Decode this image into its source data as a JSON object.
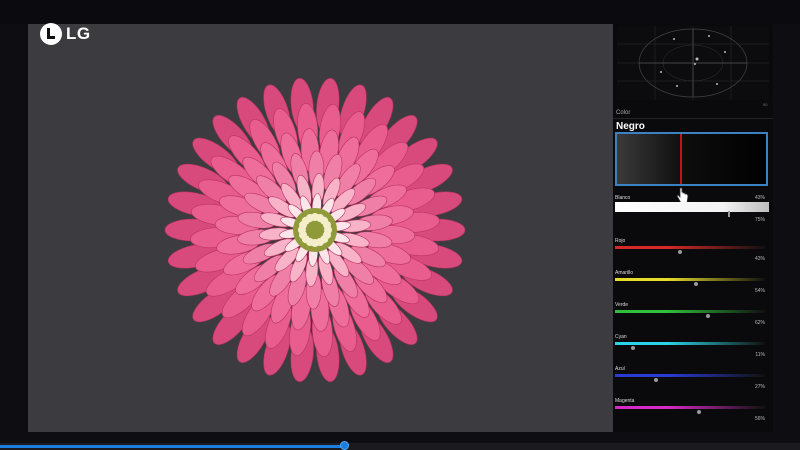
{
  "brand": {
    "logo_text": "LG"
  },
  "scope": {
    "label": "50"
  },
  "panel": {
    "title": "Color",
    "selected_color": "Negro"
  },
  "blanco": {
    "label": "Blanco",
    "percent_top": "43%",
    "percent_bottom": "75%",
    "level": 0.75
  },
  "sliders": [
    {
      "label": "Rojo",
      "percent": "43%",
      "color": "#d62828",
      "level": 0.43
    },
    {
      "label": "Amarillo",
      "percent": "54%",
      "color": "#e6dc2b",
      "level": 0.54
    },
    {
      "label": "Verde",
      "percent": "62%",
      "color": "#2fbf3a",
      "level": 0.62
    },
    {
      "label": "Cyan",
      "percent": "11%",
      "color": "#2ad4e6",
      "level": 0.11
    },
    {
      "label": "Azul",
      "percent": "27%",
      "color": "#2a3ad6",
      "level": 0.27
    },
    {
      "label": "Magenta",
      "percent": "56%",
      "color": "#d62ac6",
      "level": 0.56
    }
  ],
  "playback": {
    "progress": 0.43
  },
  "icons": {
    "cursor": "hand-pointer-icon",
    "logo": "lg-logo-icon"
  }
}
